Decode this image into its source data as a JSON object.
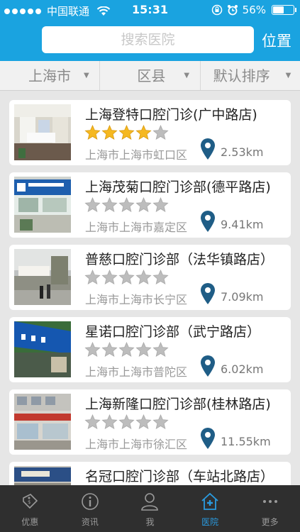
{
  "status_bar": {
    "carrier": "中国联通",
    "time": "15:31",
    "battery": "56%",
    "battery_level": 0.56
  },
  "header": {
    "search_placeholder": "搜索医院",
    "location_button": "位置"
  },
  "filters": {
    "city": "上海市",
    "district": "区县",
    "sort": "默认排序"
  },
  "hospitals": [
    {
      "name": "上海登特口腔门诊(广中路店)",
      "rating": 4,
      "address": "上海市上海市虹口区",
      "distance": "2.53km",
      "thumb": "thumb-lobby"
    },
    {
      "name": "上海茂菊口腔门诊部(德平路店)",
      "rating": 0,
      "address": "上海市上海市嘉定区",
      "distance": "9.41km",
      "thumb": "thumb-storefront-blue"
    },
    {
      "name": "普慈口腔门诊部（法华镇路店）",
      "rating": 0,
      "address": "上海市上海市长宁区",
      "distance": "7.09km",
      "thumb": "thumb-street"
    },
    {
      "name": "星诺口腔门诊部（武宁路店）",
      "rating": 0,
      "address": "上海市上海市普陀区",
      "distance": "6.02km",
      "thumb": "thumb-blue-sign"
    },
    {
      "name": "上海新隆口腔门诊部(桂林路店)",
      "rating": 0,
      "address": "上海市上海市徐汇区",
      "distance": "11.55km",
      "thumb": "thumb-building"
    },
    {
      "name": "名冠口腔门诊部（车站北路店）",
      "rating": 0,
      "address": "",
      "distance": "",
      "thumb": "thumb-sign"
    }
  ],
  "tabs": [
    {
      "label": "优惠",
      "icon": "coupon-icon",
      "active": false
    },
    {
      "label": "资讯",
      "icon": "info-icon",
      "active": false
    },
    {
      "label": "我",
      "icon": "user-icon",
      "active": false
    },
    {
      "label": "医院",
      "icon": "hospital-icon",
      "active": true
    },
    {
      "label": "更多",
      "icon": "more-icon",
      "active": false
    }
  ],
  "colors": {
    "accent": "#1aa3e0",
    "tab_active": "#2a9be0",
    "star_gold": "#f5b820",
    "star_gray": "#bdbdbd",
    "pin": "#1f5d86"
  }
}
